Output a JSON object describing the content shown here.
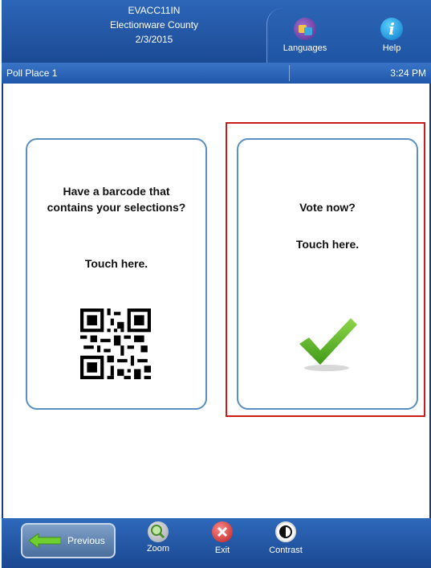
{
  "header": {
    "line1": "EVACC11IN",
    "line2": "Electionware County",
    "line3": "2/3/2015",
    "languages_label": "Languages",
    "help_label": "Help"
  },
  "subbar": {
    "poll_place": "Poll Place 1",
    "time": "3:24 PM"
  },
  "card_barcode": {
    "line1": "Have a barcode that",
    "line2": "contains your selections?",
    "touch": "Touch here."
  },
  "card_vote": {
    "line1": "Vote now?",
    "touch": "Touch here."
  },
  "footer": {
    "previous_label": "Previous",
    "zoom_label": "Zoom",
    "exit_label": "Exit",
    "contrast_label": "Contrast"
  },
  "icons": [
    "languages-icon",
    "help-icon",
    "qr-code-icon",
    "checkmark-icon",
    "arrow-left-icon",
    "zoom-icon",
    "exit-icon",
    "contrast-icon"
  ],
  "colors": {
    "header_blue": "#1b4a94",
    "card_border": "#5a8fc2",
    "highlight_red": "#cc1b1b",
    "check_green": "#5cb82b"
  }
}
